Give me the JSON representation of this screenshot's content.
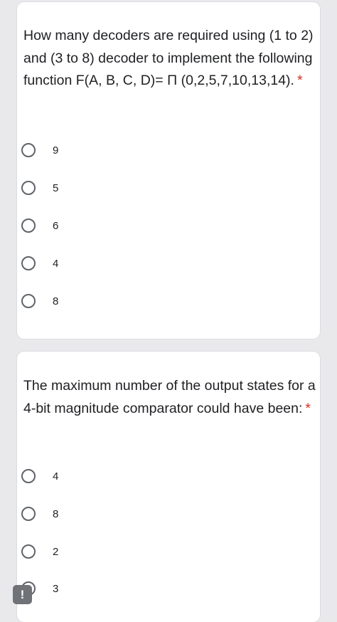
{
  "questions": [
    {
      "text": "How many decoders are required using (1 to 2) and (3 to 8) decoder to implement the following function F(A, B, C, D)= Π (0,2,5,7,10,13,14).",
      "required_mark": "*",
      "options": [
        "9",
        "5",
        "6",
        "4",
        "8"
      ]
    },
    {
      "text": "The maximum number of the output states for a 4-bit magnitude comparator could have been:",
      "required_mark": "*",
      "options": [
        "4",
        "8",
        "2",
        "3"
      ]
    }
  ],
  "report_button": {
    "glyph": "!"
  },
  "colors": {
    "page_background": "#e9e9ec",
    "card_background": "#ffffff",
    "required_asterisk": "#d93025",
    "radio_border": "#5f6368",
    "report_button": "#6f7276"
  },
  "icons": {
    "radio": "radio-unchecked-icon",
    "report": "report-problem-icon"
  }
}
